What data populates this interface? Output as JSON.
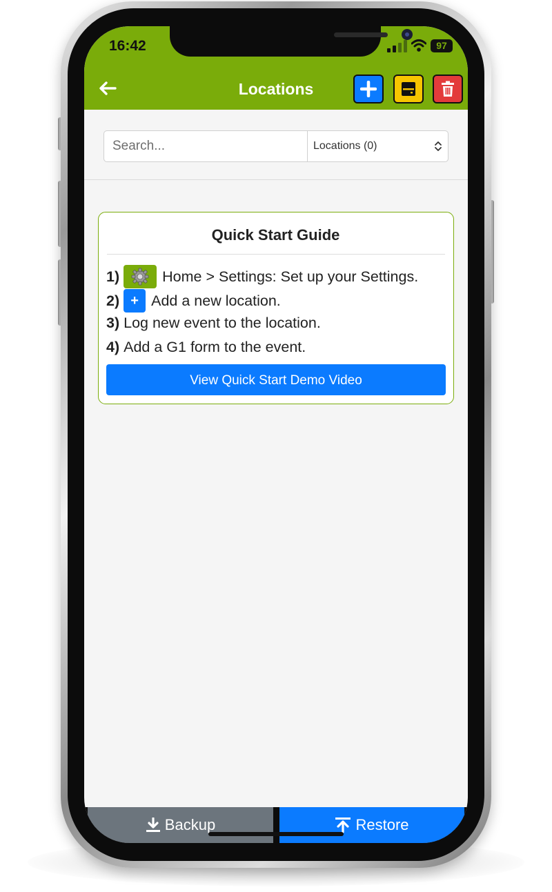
{
  "status_bar": {
    "time": "16:42",
    "battery": "97",
    "icons": [
      "signal-bars-icon",
      "wifi-icon",
      "battery-icon"
    ]
  },
  "header": {
    "title": "Locations",
    "back_icon": "arrow-left-icon",
    "actions": [
      {
        "name": "add",
        "icon": "plus-icon",
        "color": "#0b7bff"
      },
      {
        "name": "save",
        "icon": "floppy-disk-icon",
        "color": "#f7c500"
      },
      {
        "name": "delete",
        "icon": "trash-icon",
        "color": "#e33b3b"
      }
    ],
    "color": "#7aac0a"
  },
  "filter": {
    "search_placeholder": "Search...",
    "search_value": "",
    "select_value": "Locations (0)"
  },
  "quick_start": {
    "title": "Quick Start Guide",
    "steps": [
      {
        "num": "1)",
        "icon": "gear-icon",
        "text": "Home > Settings: Set up your Settings."
      },
      {
        "num": "2)",
        "icon": "plus-icon",
        "icon_text": "+",
        "text": "Add a new location."
      },
      {
        "num": "3)",
        "text": "Log new event to the location."
      },
      {
        "num": "4)",
        "text": "Add a G1 form to the event."
      }
    ],
    "video_button": "View Quick Start Demo Video"
  },
  "footer": {
    "backup_label": "Backup",
    "backup_icon": "download-icon",
    "restore_label": "Restore",
    "restore_icon": "upload-icon"
  },
  "colors": {
    "primary": "#0b7bff",
    "secondary": "#6c757d",
    "warning": "#f7c500",
    "danger": "#e33b3b",
    "brand_green": "#7aac0a"
  }
}
